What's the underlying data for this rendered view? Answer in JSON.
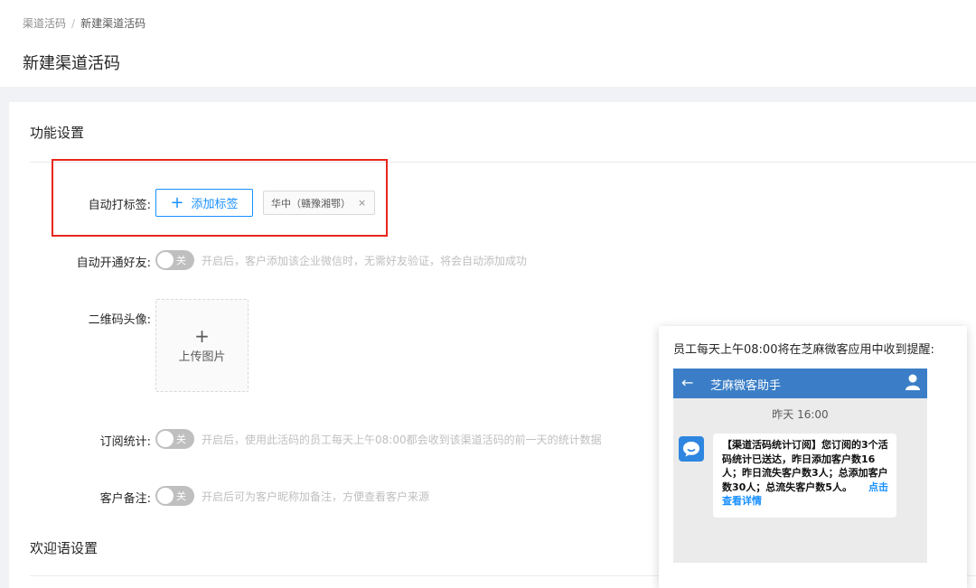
{
  "breadcrumb": {
    "parent": "渠道活码",
    "separator": "/",
    "current": "新建渠道活码"
  },
  "page": {
    "title": "新建渠道活码"
  },
  "sections": {
    "function": "功能设置",
    "welcome": "欢迎语设置"
  },
  "auto_tag": {
    "label": "自动打标签:",
    "add_button": "添加标签",
    "tag": "华中（赣豫湘鄂）",
    "tag_close": "×"
  },
  "auto_friend": {
    "label": "自动开通好友:",
    "switch": "关",
    "hint": "开启后，客户添加该企业微信时，无需好友验证，将会自动添加成功"
  },
  "qr_avatar": {
    "label": "二维码头像:",
    "upload_plus": "+",
    "upload_text": "上传图片"
  },
  "subscribe": {
    "label": "订阅统计:",
    "switch": "关",
    "hint": "开启后，使用此活码的员工每天上午08:00都会收到该渠道活码的前一天的统计数据"
  },
  "remark": {
    "label": "客户备注:",
    "switch": "关",
    "hint": "开启后可为客户昵称加备注，方便查看客户来源"
  },
  "popover": {
    "title": "员工每天上午08:00将在芝麻微客应用中收到提醒:",
    "app_name": "芝麻微客助手",
    "time": "昨天 16:00",
    "message": "【渠道活码统计订阅】您订阅的3个活码统计已送达，昨日添加客户数16人；昨日流失客户数3人；总添加客户数30人；总流失客户数5人。",
    "link": "点击查看详情"
  },
  "colors": {
    "primary": "#1890ff",
    "highlight": "#e8261c",
    "phone_bar": "#3b7ec7"
  }
}
